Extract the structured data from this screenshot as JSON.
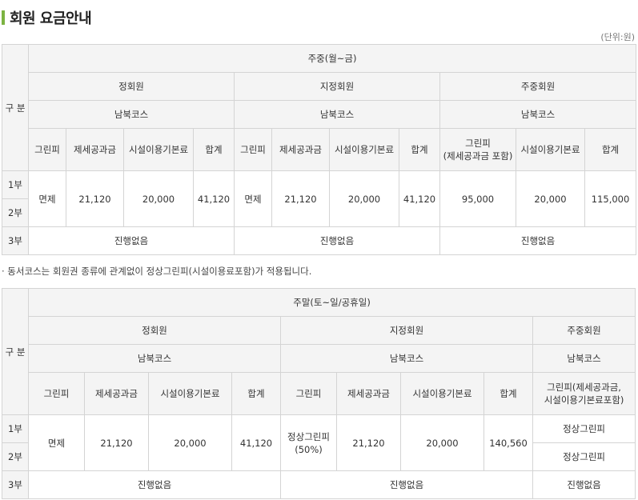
{
  "page": {
    "title": "회원 요금안내",
    "unit": "(단위:원)",
    "note": "· 동서코스는 회원권 종류에 관계없이 정상그린피(시설이용료포함)가 적용됩니다."
  },
  "weekday": {
    "gubun": "구 분",
    "period": "주중(월~금)",
    "groups": {
      "regular": {
        "name": "정회원",
        "course": "남북코스"
      },
      "designated": {
        "name": "지정회원",
        "course": "남북코스"
      },
      "weekday_member": {
        "name": "주중회원",
        "course": "남북코스"
      }
    },
    "cols": {
      "regular": [
        "그린피",
        "제세공과금",
        "시설이용기본료",
        "합계"
      ],
      "designated": [
        "그린피",
        "제세공과금",
        "시설이용기본료",
        "합계"
      ],
      "weekday_member_green": [
        "그린피",
        "(제세공과금 포함)"
      ],
      "weekday_member": [
        "시설이용기본료",
        "합계"
      ]
    },
    "parts": [
      "1부",
      "2부",
      "3부"
    ],
    "regular_values": [
      "면제",
      "21,120",
      "20,000",
      "41,120"
    ],
    "designated_values": [
      "면제",
      "21,120",
      "20,000",
      "41,120"
    ],
    "weekday_member_values": [
      "95,000",
      "20,000",
      "115,000"
    ],
    "no_progress": "진행없음"
  },
  "weekend": {
    "gubun": "구 분",
    "period": "주말(토~일/공휴일)",
    "groups": {
      "regular": {
        "name": "정회원",
        "course": "남북코스"
      },
      "designated": {
        "name": "지정회원",
        "course": "남북코스"
      },
      "weekday_member": {
        "name": "주중회원",
        "course": "남북코스"
      }
    },
    "cols": {
      "regular": [
        "그린피",
        "제세공과금",
        "시설이용기본료",
        "합계"
      ],
      "designated": [
        "그린피",
        "제세공과금",
        "시설이용기본료",
        "합계"
      ],
      "weekday_member": [
        "그린피(제세공과금,",
        "시설이용기본료포함)"
      ]
    },
    "parts": [
      "1부",
      "2부",
      "3부"
    ],
    "regular_values": [
      "면제",
      "21,120",
      "20,000",
      "41,120"
    ],
    "designated_green": [
      "정상그린피",
      "(50%)"
    ],
    "designated_values": [
      "21,120",
      "20,000",
      "140,560"
    ],
    "weekday_member_values": [
      "정상그린피",
      "정상그린피"
    ],
    "no_progress": "진행없음"
  }
}
